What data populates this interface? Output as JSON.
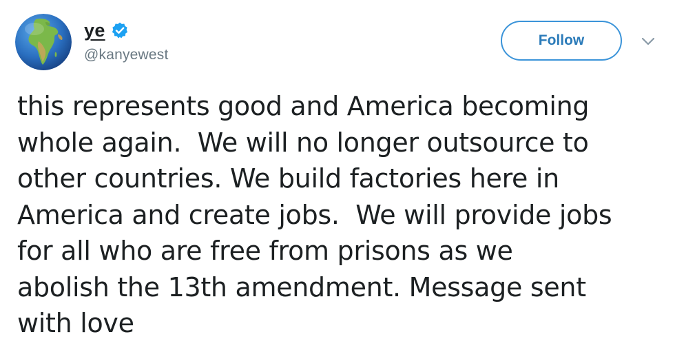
{
  "author": {
    "display_name": "ye",
    "handle": "@kanyewest",
    "verified": true,
    "avatar_icon": "earth-globe-emoji",
    "accent_color": "#1da1f2"
  },
  "actions": {
    "follow_label": "Follow",
    "more_menu_icon": "chevron-down-icon"
  },
  "tweet": {
    "text_lines": [
      "this represents good and America becoming",
      "whole again.  We will no longer outsource to",
      "other countries. We build factories here in",
      "America and create jobs.  We will provide jobs",
      "for all who are free from prisons as we",
      "abolish the 13th amendment. Message sent",
      "with love"
    ]
  }
}
